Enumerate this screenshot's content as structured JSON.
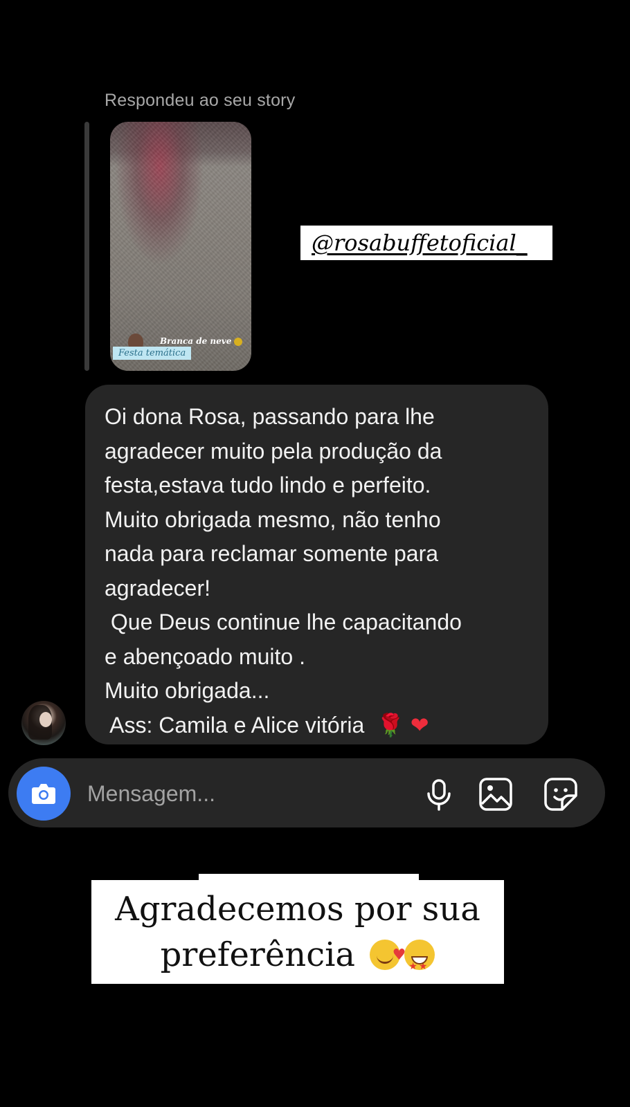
{
  "story_reply": {
    "label": "Respondeu ao seu story",
    "thumbnail_caption": "Branca de neve",
    "thumbnail_tag": "Festa temática"
  },
  "mention_sticker": "@rosabuffetoficial_",
  "message": {
    "lines": [
      "Oi dona Rosa, passando para lhe",
      "agradecer muito pela produção da",
      "festa,estava tudo lindo e perfeito.",
      "Muito obrigada mesmo, não tenho",
      "nada para reclamar somente para",
      "agradecer!",
      " Que Deus continue lhe capacitando",
      "e abençoado muito .",
      "Muito obrigada...",
      " Ass: Camila e Alice vitória"
    ],
    "trailing_emojis": [
      "🌹",
      "❤"
    ]
  },
  "composer": {
    "placeholder": "Mensagem...",
    "accent_color": "#3d7cf2"
  },
  "overlay": {
    "line1": "Agradecemos por sua",
    "line2": "preferência",
    "emoji_icons": [
      "smiling-face-with-hearts-icon",
      "star-struck-icon"
    ]
  }
}
